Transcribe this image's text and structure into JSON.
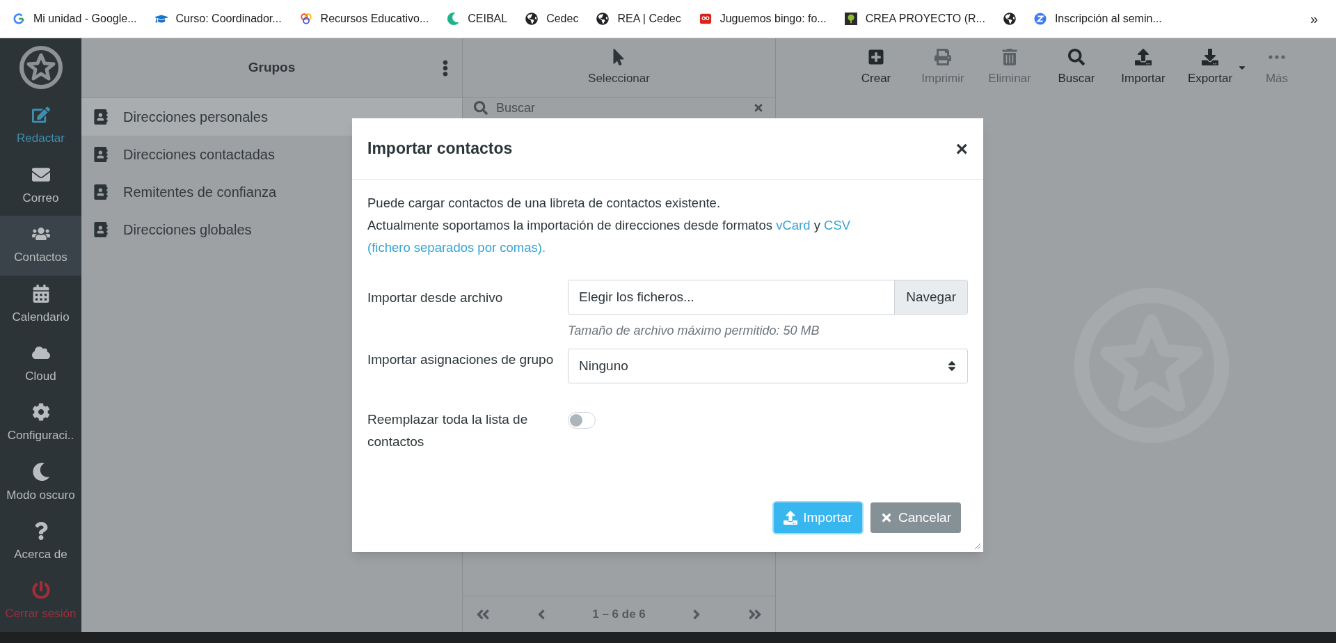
{
  "bookmarks": {
    "items": [
      {
        "kind": "labelled",
        "label": "Mi unidad - Google..."
      },
      {
        "kind": "labelled",
        "label": "Curso: Coordinador..."
      },
      {
        "kind": "labelled",
        "label": "Recursos Educativo..."
      },
      {
        "kind": "labelled",
        "label": "CEIBAL"
      },
      {
        "kind": "labelled",
        "label": "Cedec"
      },
      {
        "kind": "labelled",
        "label": "REA | Cedec"
      },
      {
        "kind": "labelled",
        "label": "Juguemos bingo: fo..."
      },
      {
        "kind": "labelled",
        "label": "CREA PROYECTO (R..."
      },
      {
        "kind": "icon_only"
      },
      {
        "kind": "labelled",
        "label": "Inscripción al semin..."
      }
    ],
    "overflow": "»"
  },
  "sidebar": {
    "items": [
      {
        "label": "Redactar",
        "kind": "accent",
        "selected": false
      },
      {
        "label": "Correo",
        "kind": "normal",
        "selected": false
      },
      {
        "label": "Contactos",
        "kind": "normal",
        "selected": true
      },
      {
        "label": "Calendario",
        "kind": "normal",
        "selected": false
      },
      {
        "label": "Cloud",
        "kind": "normal",
        "selected": false
      },
      {
        "label": "Configuraci..",
        "kind": "normal",
        "selected": false
      },
      {
        "label": "Modo oscuro",
        "kind": "normal",
        "selected": false
      },
      {
        "label": "Acerca de",
        "kind": "normal",
        "selected": false
      },
      {
        "label": "Cerrar sesión",
        "kind": "danger",
        "selected": false
      }
    ]
  },
  "groups": {
    "title": "Grupos",
    "items": [
      {
        "label": "Direcciones personales",
        "selected": true
      },
      {
        "label": "Direcciones contactadas",
        "selected": false
      },
      {
        "label": "Remitentes de confianza",
        "selected": false
      },
      {
        "label": "Direcciones globales",
        "selected": false
      }
    ]
  },
  "list_panel": {
    "select_label": "Seleccionar",
    "search_placeholder": "Buscar",
    "pagination": "1 – 6 de 6"
  },
  "toolbar": [
    {
      "label": "Crear",
      "disabled": false
    },
    {
      "label": "Imprimir",
      "disabled": true
    },
    {
      "label": "Eliminar",
      "disabled": true
    },
    {
      "label": "Buscar",
      "disabled": false
    },
    {
      "label": "Importar",
      "disabled": false
    },
    {
      "label": "Exportar",
      "disabled": false,
      "has_menu": true
    },
    {
      "label": "Más",
      "disabled": true
    }
  ],
  "dialog": {
    "title": "Importar contactos",
    "close": "×",
    "intro": [
      [
        {
          "text": "Puede cargar contactos de una libreta de contactos existente.",
          "kind": "text"
        }
      ],
      [
        {
          "text": "Actualmente soportamos la importación de direcciones desde formatos",
          "kind": "text"
        },
        {
          "text": "vCard",
          "kind": "link"
        },
        {
          "text": "y",
          "kind": "text"
        },
        {
          "text": "CSV",
          "kind": "link"
        },
        {
          "text": "(fichero separados por comas).",
          "kind": "link"
        }
      ]
    ],
    "file_label": "Importar desde archivo",
    "file_placeholder": "Elegir los ficheros...",
    "browse": "Navegar",
    "hint": "Tamaño de archivo máximo permitido: 50 MB",
    "group_label": "Importar asignaciones de grupo",
    "group_value": "Ninguno",
    "replace_label": "Reemplazar toda la lista de contactos",
    "replace_on": false,
    "buttons": [
      {
        "label": "Importar",
        "kind": "primary"
      },
      {
        "label": "Cancelar",
        "kind": "secondary"
      }
    ]
  }
}
